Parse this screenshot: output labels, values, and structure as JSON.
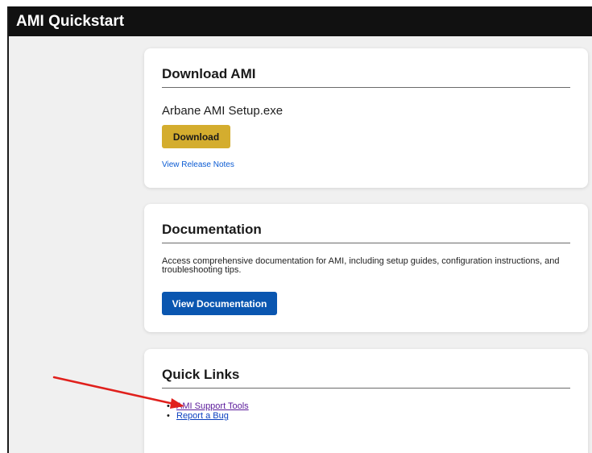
{
  "app": {
    "title": "AMI Quickstart"
  },
  "download": {
    "heading": "Download AMI",
    "file_name": "Arbane AMI Setup.exe",
    "button_label": "Download",
    "release_notes_link": "View Release Notes"
  },
  "documentation": {
    "heading": "Documentation",
    "description": "Access comprehensive documentation for AMI, including setup guides, configuration instructions, and troubleshooting tips.",
    "button_label": "View Documentation"
  },
  "quick_links": {
    "heading": "Quick Links",
    "items": [
      {
        "label": "AMI Support Tools"
      },
      {
        "label": "Report a Bug"
      }
    ]
  },
  "colors": {
    "titlebar": "#111111",
    "download_button": "#d4ad2e",
    "docs_button": "#0a56b0",
    "annotation_arrow": "#e0201c"
  },
  "icons": {
    "annotation": "red-arrow"
  }
}
